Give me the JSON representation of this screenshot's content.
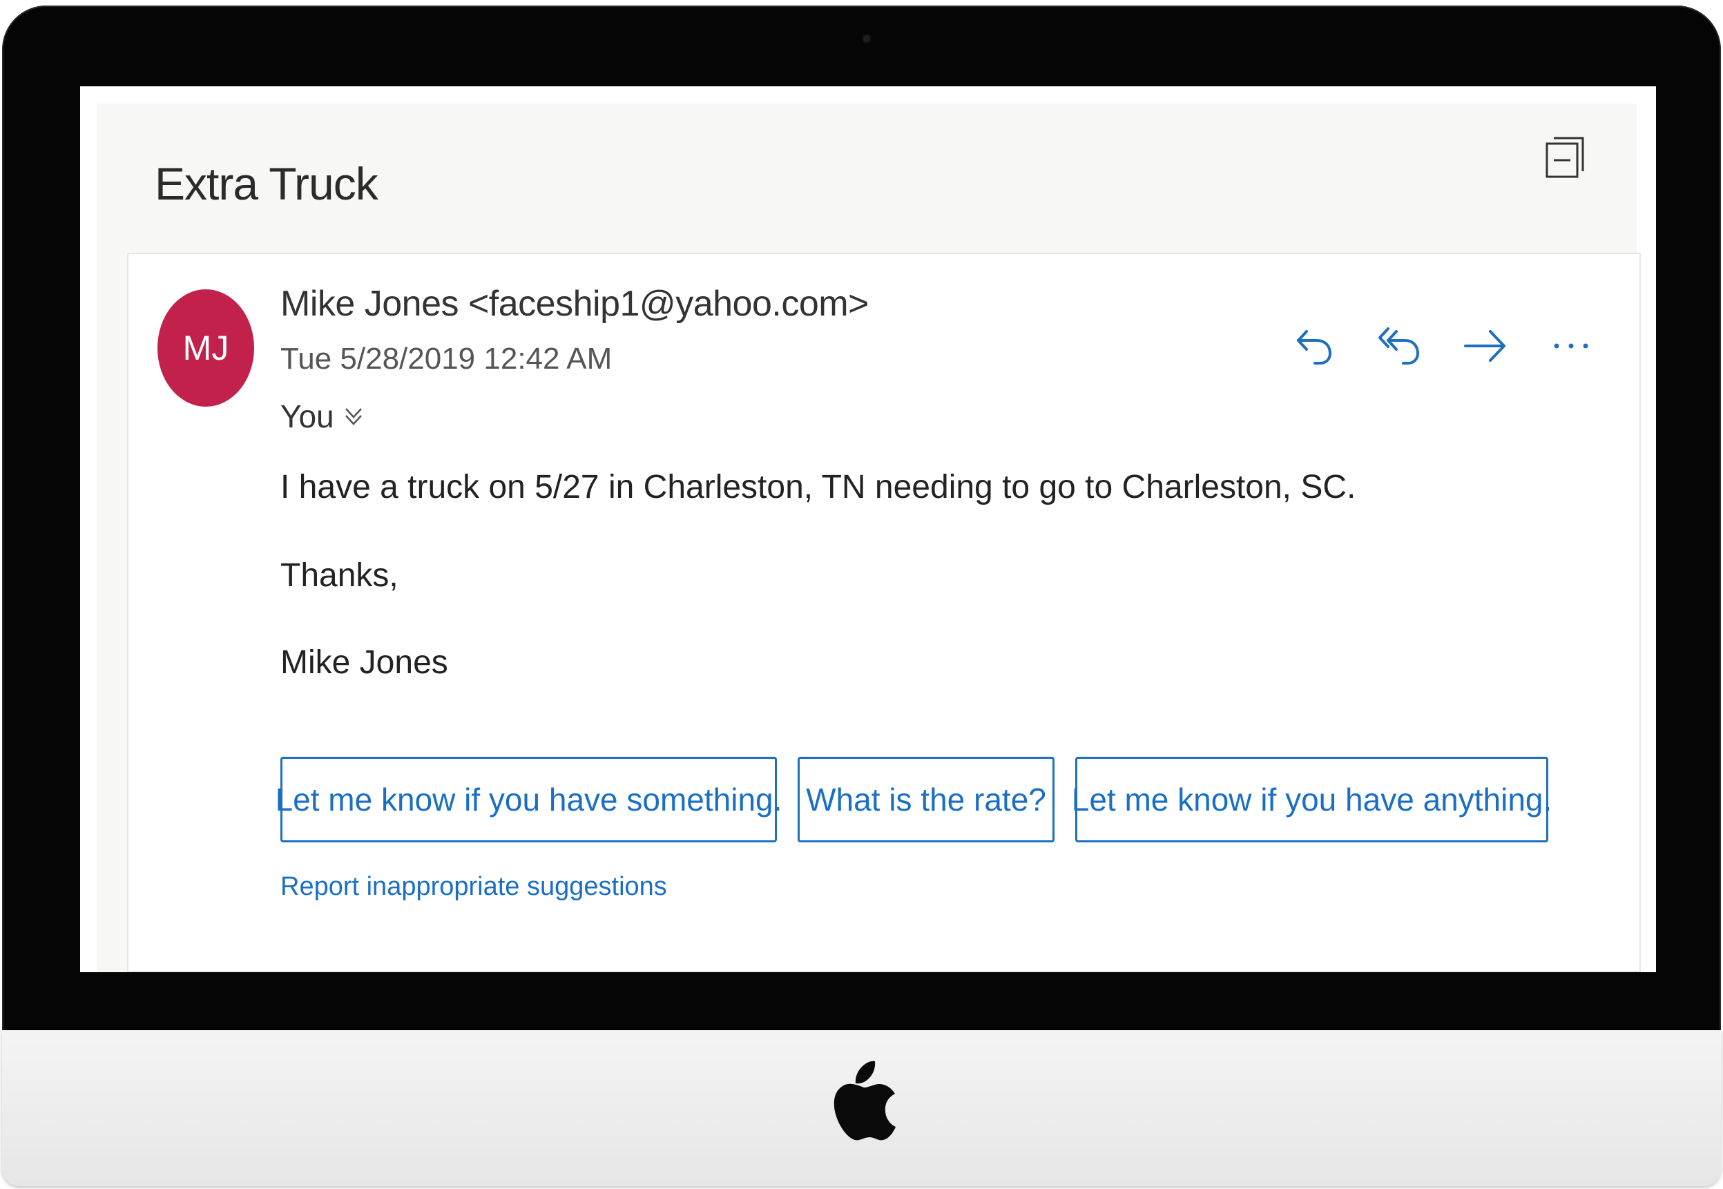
{
  "email": {
    "subject": "Extra Truck",
    "sender": {
      "initials": "MJ",
      "display": "Mike Jones <faceship1@yahoo.com>",
      "avatar_color": "#c1214a"
    },
    "date": "Tue 5/28/2019 12:42 AM",
    "to": "You",
    "body": {
      "line1": "I have a truck on 5/27 in Charleston, TN needing to go to Charleston, SC.",
      "line2": "Thanks,",
      "line3": "Mike Jones"
    },
    "actions": [
      "reply-icon",
      "reply-all-icon",
      "forward-icon",
      "more-options-icon"
    ],
    "suggested_replies": [
      "Let me know if you have something.",
      "What is the rate?",
      "Let me know if you have anything."
    ],
    "report_link": "Report inappropriate suggestions"
  },
  "colors": {
    "accent": "#1d6fbf",
    "avatar": "#c1214a",
    "pane_background": "#f7f7f6"
  },
  "icons": {
    "top_right": "popout-icon",
    "recipient_expand": "chevron-down-icon",
    "device_logo": "apple-logo-icon"
  }
}
